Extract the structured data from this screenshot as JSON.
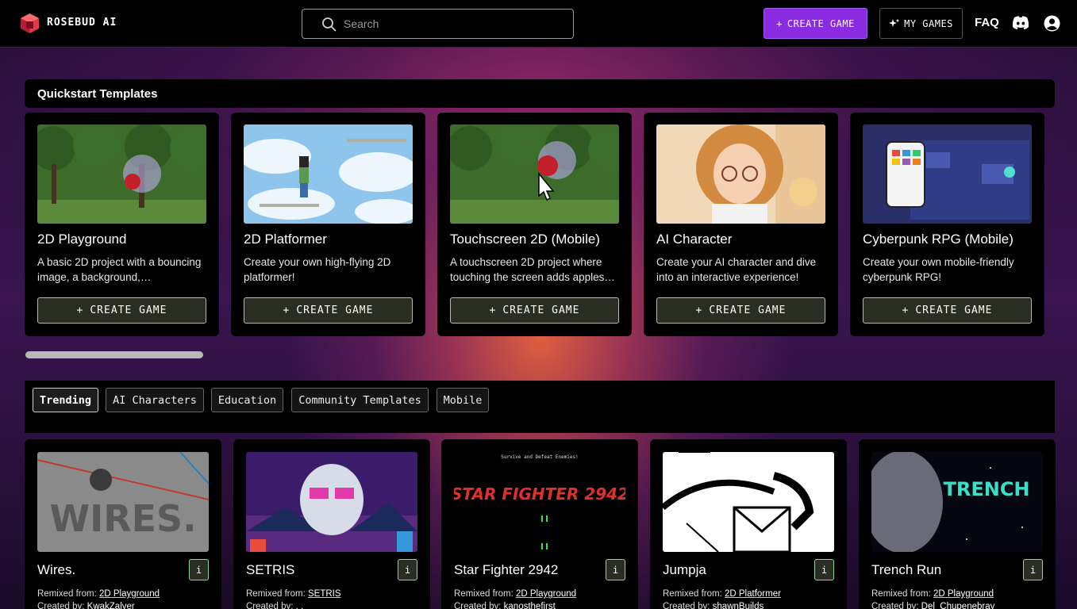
{
  "header": {
    "brand": "ROSEBUD AI",
    "search_placeholder": "Search",
    "create_game": "CREATE GAME",
    "my_games": "MY GAMES",
    "faq": "FAQ"
  },
  "quickstart": {
    "title": "Quickstart Templates",
    "button_label": "CREATE GAME",
    "templates": [
      {
        "title": "2D Playground",
        "desc": "A basic 2D project with a bouncing image, a background,…"
      },
      {
        "title": "2D Platformer",
        "desc": "Create your own high-flying 2D platformer!"
      },
      {
        "title": "Touchscreen 2D (Mobile)",
        "desc": "A touchscreen 2D project where touching the screen adds apples…"
      },
      {
        "title": "AI Character",
        "desc": "Create your AI character and dive into an interactive experience!"
      },
      {
        "title": "Cyberpunk RPG (Mobile)",
        "desc": "Create your own mobile-friendly cyberpunk RPG!"
      }
    ]
  },
  "tabs": [
    "Trending",
    "AI Characters",
    "Education",
    "Community Templates",
    "Mobile"
  ],
  "games": {
    "remixed_label": "Remixed from:",
    "created_label": "Created by:",
    "info_label": "i",
    "items": [
      {
        "title": "Wires.",
        "remixed_from": "2D Playground",
        "created_by": "KwakZalver",
        "thumb_text": "WIRES."
      },
      {
        "title": "SETRIS",
        "remixed_from": "SETRIS",
        "created_by": ". .",
        "thumb_text": ""
      },
      {
        "title": "Star Fighter 2942",
        "remixed_from": "2D Playground",
        "created_by": "kanosthefirst",
        "thumb_text": "STAR FIGHTER 2942",
        "thumb_sub": "Survive and Defeat Enemies!"
      },
      {
        "title": "Jumpja",
        "remixed_from": "2D Platformer",
        "created_by": "shawnBuilds",
        "thumb_text": ""
      },
      {
        "title": "Trench Run",
        "remixed_from": "2D Playground",
        "created_by": "Del_Chupenebray",
        "thumb_text": "TRENCH"
      }
    ]
  },
  "colors": {
    "accent_purple": "#8a2be2",
    "button_border_green": "#8fd4a0",
    "link_underline": "#e6d24a"
  }
}
